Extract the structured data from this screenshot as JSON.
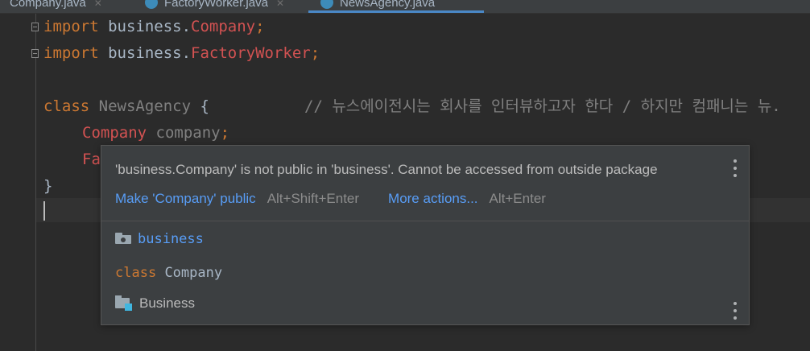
{
  "editor_tabs": [
    {
      "label": "Company.java",
      "active": false
    },
    {
      "label": "FactoryWorker.java",
      "active": false
    },
    {
      "label": "NewsAgency.java",
      "active": true
    }
  ],
  "code": {
    "line1": {
      "kw": "import",
      "pkg": " business.",
      "cls": "Company",
      "end": ";"
    },
    "line2": {
      "kw": "import",
      "pkg": " business.",
      "cls": "FactoryWorker",
      "end": ";"
    },
    "line4": {
      "kw": "class",
      "name": " NewsAgency",
      "brace": " {",
      "comment": "// 뉴스에이전시는 회사를 인터뷰하고자 한다 / 하지만 컴패니는 뉴."
    },
    "line5": {
      "type": "Company",
      "field": " company",
      "end": ";"
    },
    "line6": {
      "partial": "Fa"
    },
    "line7": {
      "brace": "}"
    }
  },
  "popup": {
    "message": "'business.Company' is not public in 'business'. Cannot be accessed from outside package",
    "action1": {
      "label": "Make 'Company' public",
      "shortcut": "Alt+Shift+Enter"
    },
    "action2": {
      "label": "More actions...",
      "shortcut": "Alt+Enter"
    },
    "package_name": "business",
    "class_kw": "class",
    "class_name": "Company",
    "module_name": "Business"
  },
  "colors": {
    "background": "#2b2b2b",
    "keyword": "#cc7832",
    "error_class": "#d25252",
    "link": "#589df6",
    "popup_bg": "#3c3f41"
  }
}
